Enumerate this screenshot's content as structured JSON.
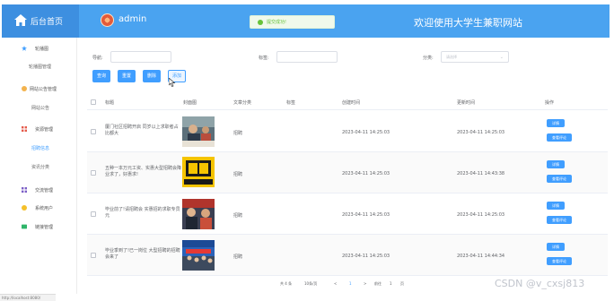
{
  "app": {
    "brand": "后台首页",
    "user": "admin",
    "site_title": "欢迎使用大学生兼职网站",
    "toast": "提交成功!"
  },
  "sidebar": {
    "items": [
      {
        "label": "轮播图",
        "icon": "star-icon",
        "color": "#409eff"
      },
      {
        "label": "轮播图管理",
        "sub": true
      },
      {
        "label": "网站公告管理",
        "icon": "circle-icon",
        "color": "#f3b34e"
      },
      {
        "label": "网站公告",
        "sub": true
      },
      {
        "label": "资源管理",
        "icon": "grid-icon",
        "color": "#e55a4a"
      },
      {
        "label": "招聘信息",
        "sub": true,
        "active": true
      },
      {
        "label": "资讯分类",
        "sub": true
      },
      {
        "label": "交流管理",
        "icon": "apps-icon",
        "color": "#7b5ec6"
      },
      {
        "label": "系统用户",
        "icon": "user-icon",
        "color": "#f5c02a"
      },
      {
        "label": "链接管理",
        "icon": "link-icon",
        "color": "#2fb56a"
      }
    ]
  },
  "filters": {
    "field1_label": "导航:",
    "field2_label": "标签:",
    "field3_label": "分类:",
    "select_placeholder": "请选择"
  },
  "buttons": {
    "query": "查询",
    "reset": "重置",
    "delete": "删除",
    "add": "添加"
  },
  "table": {
    "headers": [
      "标题",
      "封面图",
      "文章分类",
      "标签",
      "创建时间",
      "更新时间",
      "操作"
    ],
    "rows": [
      {
        "title": "厦门社区招聘开启 同岁以上求职者占比都大",
        "category": "招聘",
        "tag": "",
        "created": "2023-04-11 14:25:03",
        "updated": "2023-04-11 14:25:03"
      },
      {
        "title": "五种一本万元工资、实惠大型招聘会降业求了，好惠求!",
        "category": "招聘",
        "tag": "",
        "created": "2023-04-11 14:25:03",
        "updated": "2023-04-11 14:43:38"
      },
      {
        "title": "毕业前了!请招聘会 实惠招的求职专员元",
        "category": "招聘",
        "tag": "",
        "created": "2023-04-11 14:25:03",
        "updated": "2023-04-11 14:25:03"
      },
      {
        "title": "毕业季到了!已一岗位 大型招聘的招聘会来了",
        "category": "招聘",
        "tag": "",
        "created": "2023-04-11 14:25:03",
        "updated": "2023-04-11 14:44:34"
      }
    ],
    "actions": {
      "detail": "详情",
      "comments": "查看评论"
    }
  },
  "pagination": {
    "total": "共 4 条",
    "page_size": "10条/页",
    "prev": "<",
    "page": "1",
    "next": ">",
    "goto": "前往",
    "goto_value": "1",
    "page_suffix": "页"
  },
  "status_url": "http://localhost:8080/",
  "watermark": "CSDN @v_cxsj813"
}
